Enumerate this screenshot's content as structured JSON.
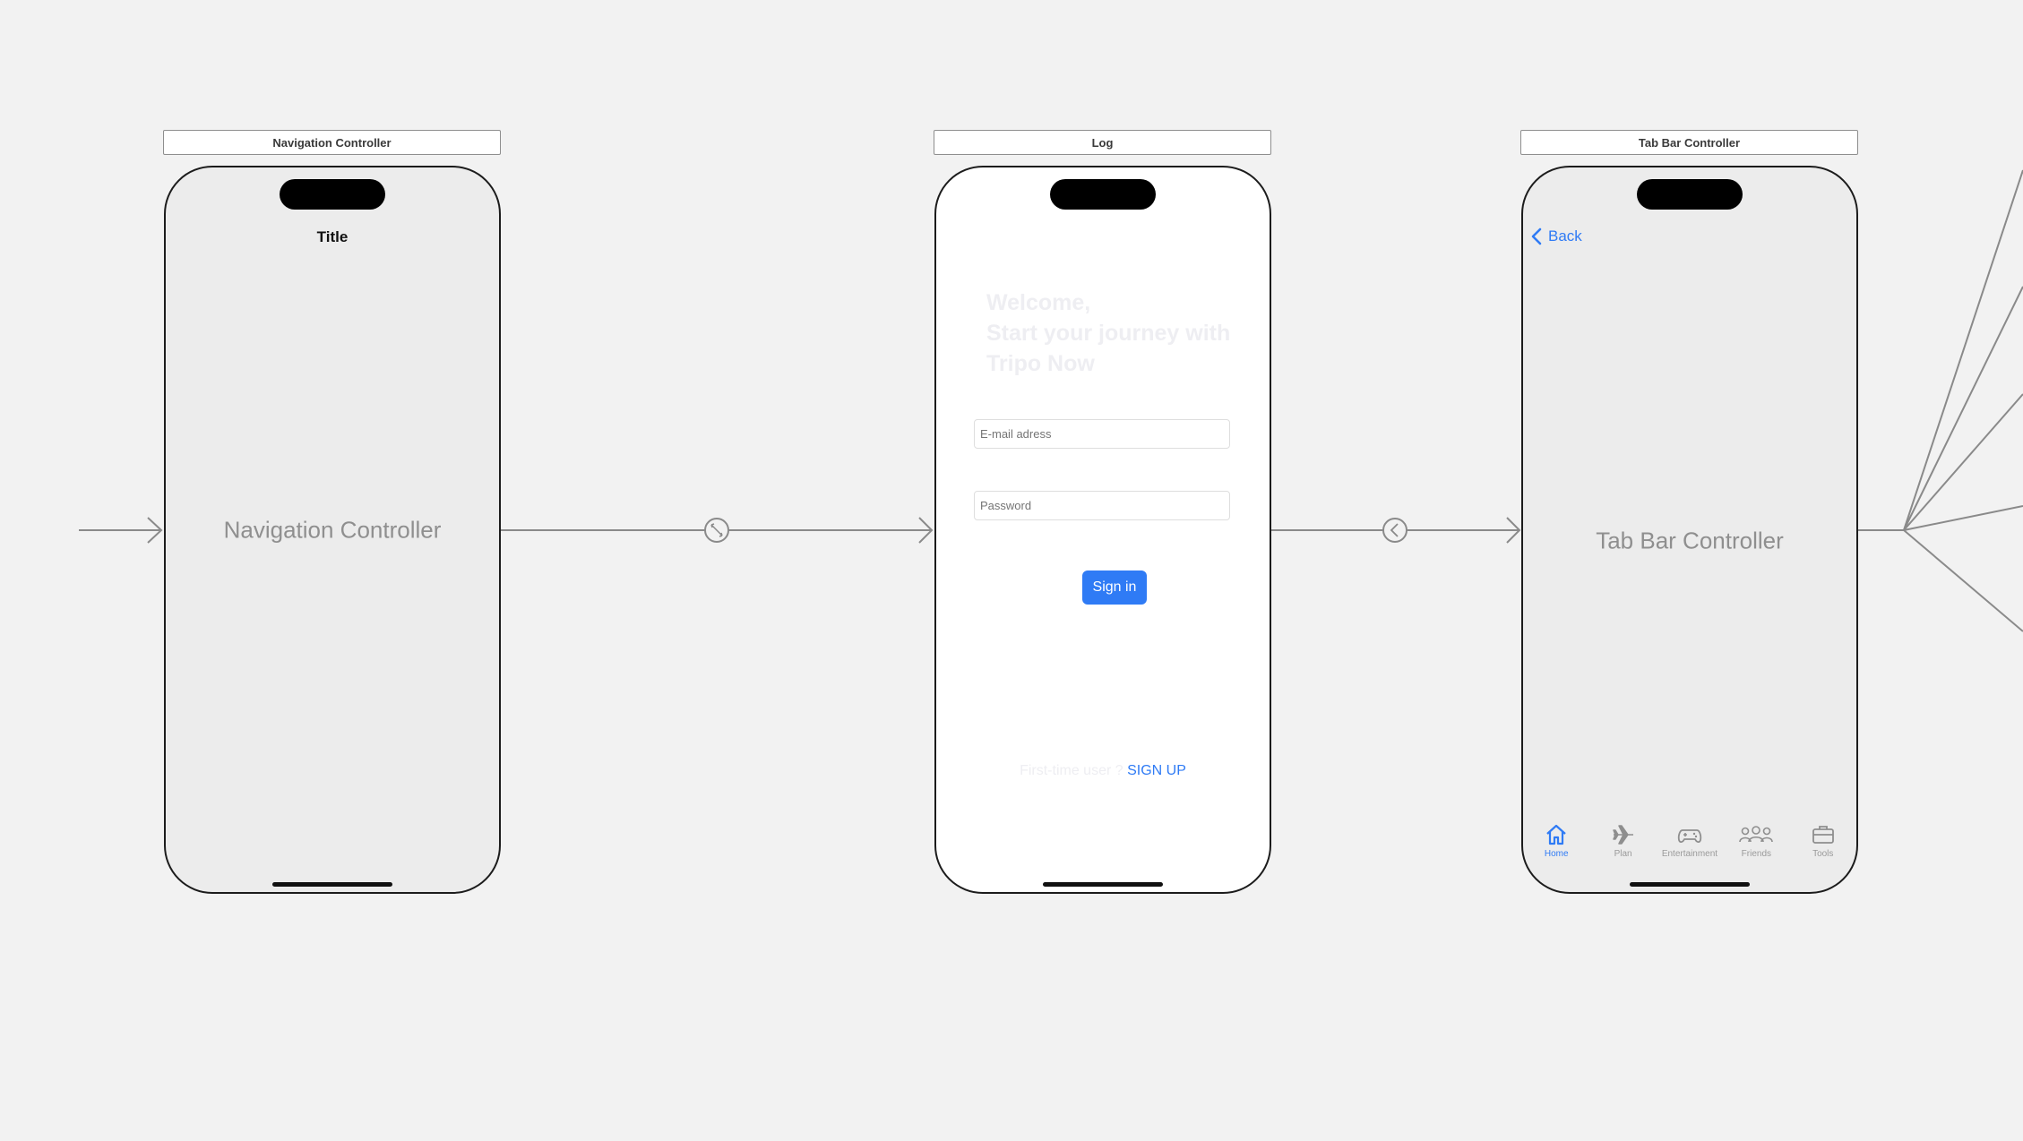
{
  "canvas": {
    "background": "#f2f2f2"
  },
  "colors": {
    "accent": "#2f7bf5",
    "segue_line": "#8a8a8a"
  },
  "scenes": {
    "navigation": {
      "header": "Navigation Controller",
      "nav_title": "Title",
      "placeholder": "Navigation Controller"
    },
    "login": {
      "header": "Log",
      "welcome_line1": "Welcome,",
      "welcome_line2": "Start your journey with",
      "welcome_line3": "Tripo Now",
      "email_placeholder": "E-mail adress",
      "password_placeholder": "Password",
      "signin_label": "Sign in",
      "first_time_text": "First-time user ?",
      "signup_label": "SIGN UP"
    },
    "tabbar": {
      "header": "Tab Bar Controller",
      "back_label": "Back",
      "placeholder": "Tab Bar Controller",
      "tabs": [
        {
          "label": "Home",
          "icon": "house-icon",
          "active": true
        },
        {
          "label": "Plan",
          "icon": "airplane-icon",
          "active": false
        },
        {
          "label": "Entertainment",
          "icon": "gamecontroller-icon",
          "active": false
        },
        {
          "label": "Friends",
          "icon": "people-icon",
          "active": false
        },
        {
          "label": "Tools",
          "icon": "briefcase-icon",
          "active": false
        }
      ]
    }
  },
  "segues": [
    {
      "from": "entry",
      "to": "navigation",
      "icon": "entry-arrow-icon"
    },
    {
      "from": "navigation",
      "to": "login",
      "icon": "root-relationship-icon"
    },
    {
      "from": "login",
      "to": "tabbar",
      "icon": "show-segue-icon"
    },
    {
      "from": "tabbar",
      "to": "tab-children",
      "icon": "relationship-fan-icon"
    }
  ]
}
